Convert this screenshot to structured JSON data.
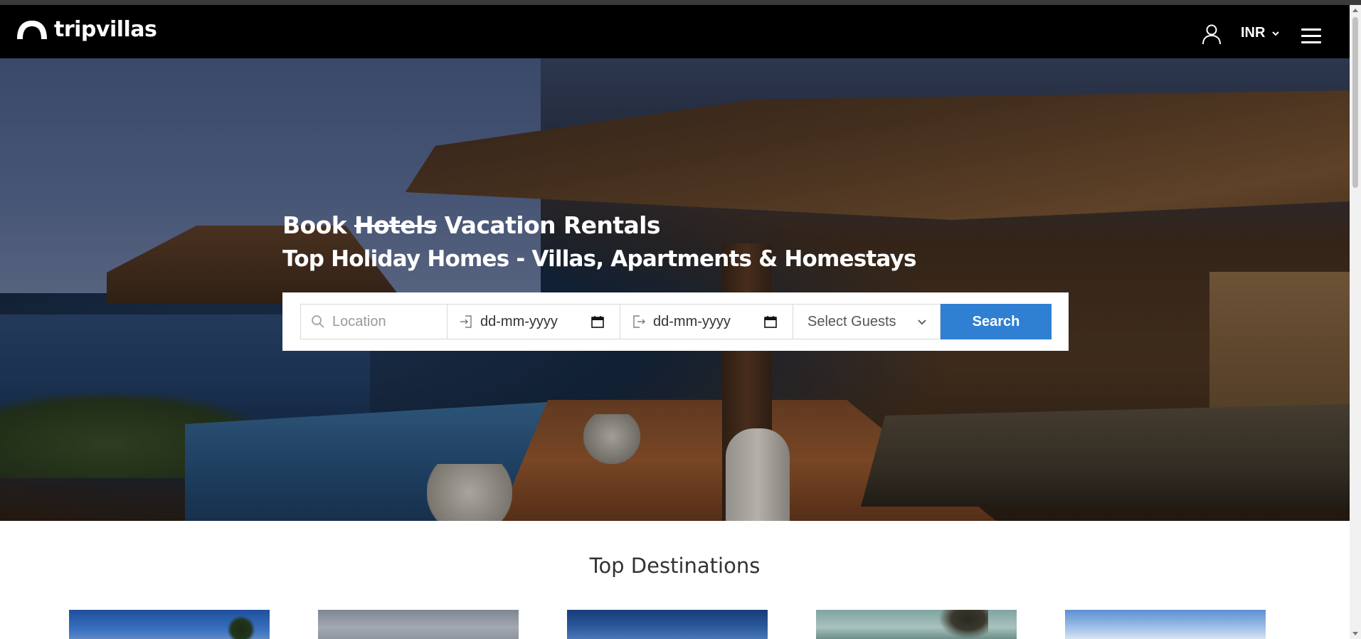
{
  "nav": {
    "logo_text": "tripvillas",
    "currency": "INR"
  },
  "hero": {
    "title_prefix": "Book",
    "title_strike": "Hotels",
    "title_suffix": "Vacation Rentals",
    "subtitle": "Top Holiday Homes - Villas, Apartments & Homestays"
  },
  "search": {
    "location_placeholder": "Location",
    "checkin_value": "dd-mm-yyyy",
    "checkout_value": "dd-mm-yyyy",
    "guests_label": "Select Guests",
    "button_label": "Search"
  },
  "destinations": {
    "title": "Top Destinations"
  },
  "colors": {
    "navbar_bg": "#000000",
    "accent": "#2f7fd3"
  }
}
